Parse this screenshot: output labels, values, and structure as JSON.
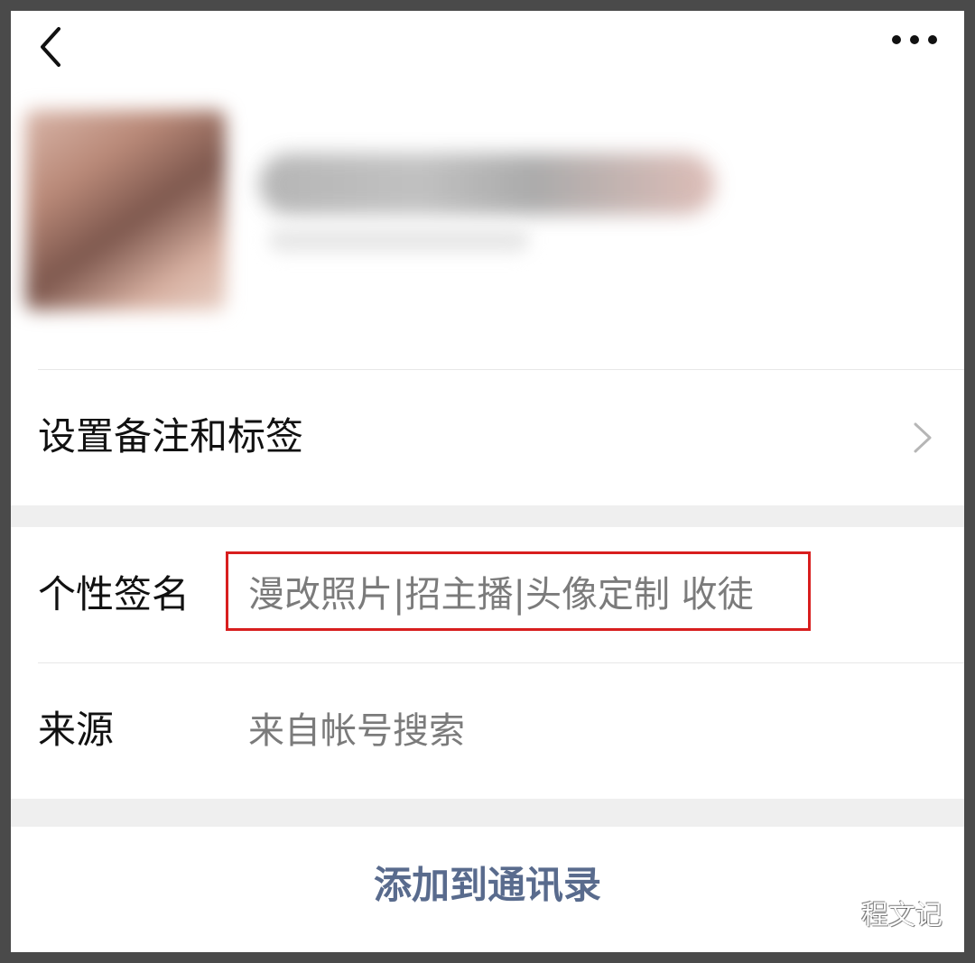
{
  "page": {
    "menu_label": "",
    "profile_name": "",
    "profile_subtitle": ""
  },
  "rows": {
    "remark_tags": "设置备注和标签",
    "signature_label": "个性签名",
    "signature_value": "漫改照片|招主播|头像定制 收徒",
    "source_label": "来源",
    "source_value": "来自帐号搜索"
  },
  "actions": {
    "add_contact": "添加到通讯录"
  },
  "watermark": {
    "text": "程文记"
  },
  "colors": {
    "accent_link": "#596b8d",
    "highlight_border": "#d81e1e",
    "screen_background": "#ffffff",
    "frame_background": "#4a4a4a"
  },
  "icons": {
    "back": "chevron-left-icon",
    "more": "more-dots-icon",
    "row_chevron": "chevron-right-icon",
    "watermark_logo": "wechat-logo-icon"
  }
}
